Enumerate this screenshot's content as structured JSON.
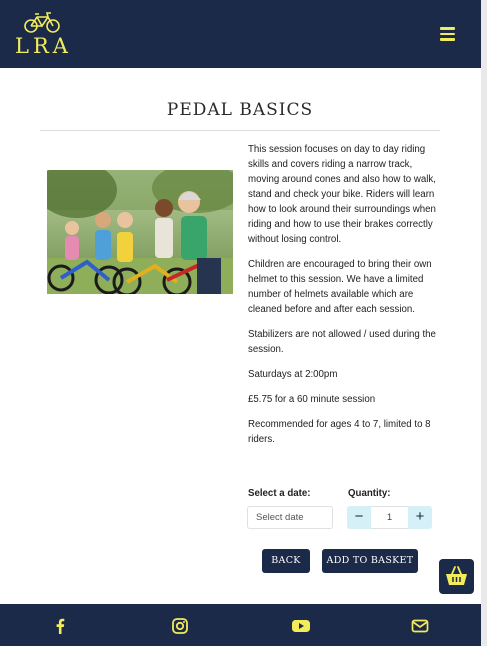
{
  "brand": {
    "logo_text": "LRA",
    "logo_icon": "bicycle-icon",
    "accent_color": "#f3ec5a",
    "nav_color": "#1b2a48"
  },
  "header": {
    "menu_icon": "hamburger-menu-icon"
  },
  "main": {
    "title": "PEDAL BASICS",
    "image_alt": "Children with bikes and helmets",
    "description": [
      "This session focuses on day to day riding skills and covers riding a narrow track, moving around cones and also how to walk, stand and check your bike. Riders will learn how to look around their surroundings when riding and how to use their brakes correctly without losing control.",
      "Children are encouraged to bring their own helmet to this session. We have a limited number of helmets available which are cleaned before and after each session.",
      "Stabilizers are not allowed / used during the session.",
      "Saturdays at 2:00pm",
      "£5.75 for a 60 minute session",
      "Recommended for ages 4 to 7, limited to 8 riders."
    ]
  },
  "form": {
    "date_label": "Select a date:",
    "date_placeholder": "Select date",
    "quantity_label": "Quantity:",
    "quantity_value": "1",
    "minus_label": "−",
    "plus_label": "+"
  },
  "buttons": {
    "back": "BACK",
    "add_to_basket": "ADD TO BASKET"
  },
  "basket": {
    "icon": "basket-icon"
  },
  "footer": {
    "icons": [
      "facebook-icon",
      "instagram-icon",
      "youtube-icon",
      "email-icon"
    ]
  }
}
